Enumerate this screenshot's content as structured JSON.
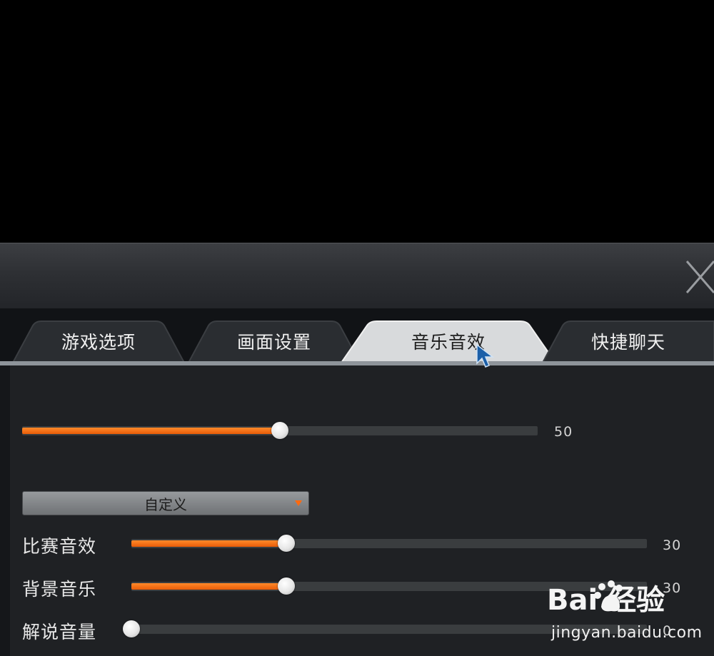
{
  "tabs": [
    {
      "label": "游戏选项",
      "active": false
    },
    {
      "label": "画面设置",
      "active": false
    },
    {
      "label": "音乐音效",
      "active": true
    },
    {
      "label": "快捷聊天",
      "active": false
    }
  ],
  "master_volume": {
    "value": 50,
    "value_text": "50"
  },
  "preset_dropdown": {
    "selected": "自定义"
  },
  "volume_rows": [
    {
      "label": "比赛音效",
      "value": 30,
      "value_text": "30"
    },
    {
      "label": "背景音乐",
      "value": 30,
      "value_text": "30"
    },
    {
      "label": "解说音量",
      "value": 0,
      "value_text": "0"
    }
  ],
  "watermark": {
    "logo_text": "Bai  经验",
    "url": "jingyan.baidu.com"
  },
  "colors": {
    "accent": "#f26a12",
    "tab_active": "#d8dadc",
    "panel": "#1f2124"
  },
  "icons": {
    "close": "close-icon",
    "cursor": "mouse-cursor-icon",
    "dropdown": "dropdown-arrow-icon"
  }
}
